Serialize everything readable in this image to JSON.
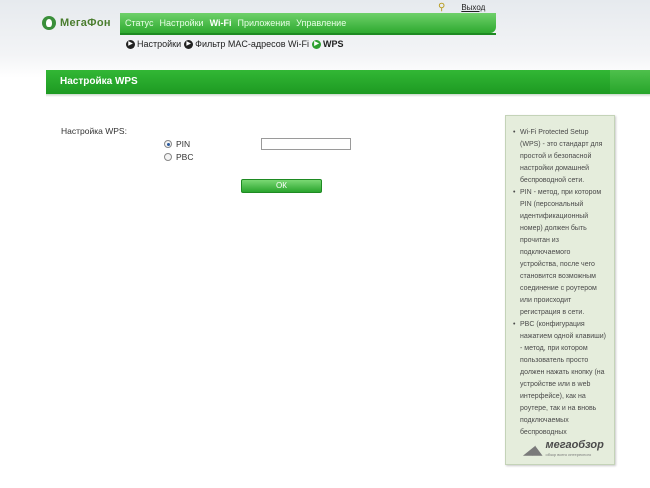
{
  "brand": {
    "name": "МегаФон"
  },
  "header": {
    "logout_label": "Выход",
    "user_icon": "user-key-icon",
    "nav": [
      {
        "label": "Статус",
        "active": false
      },
      {
        "label": "Настройки",
        "active": false
      },
      {
        "label": "Wi-Fi",
        "active": true
      },
      {
        "label": "Приложения",
        "active": false
      },
      {
        "label": "Управление",
        "active": false
      }
    ]
  },
  "breadcrumb": [
    {
      "label": "Настройки"
    },
    {
      "label": "Фильтр MAC-адресов Wi-Fi"
    },
    {
      "label": "WPS"
    }
  ],
  "section": {
    "title": "Настройка WPS"
  },
  "form": {
    "label": "Настройка WPS:",
    "options": [
      {
        "label": "PIN",
        "selected": true
      },
      {
        "label": "PBC",
        "selected": false
      }
    ],
    "pin_value": "",
    "ok_label": "ОК"
  },
  "help": {
    "items": [
      "Wi-Fi Protected Setup (WPS) - это стандарт для простой и безопасной настройки домашней беспроводной сети.",
      "PIN - метод, при котором PIN (персональный идентификационный номер) должен быть прочитан из подключаемого устройства, после чего становится возможным соединение с роутером или происходит регистрация в сети.",
      "PBC (конфигурация нажатием одной клавиши) - метод, при котором пользователь просто должен нажать кнопку (на устройстве или в web интерфейсе), как на роутере, так и на вновь подключаемых беспроводных"
    ]
  },
  "watermark": {
    "brand": "мегаобзор",
    "tagline": "обзор всего интересного"
  },
  "colors": {
    "accent": "#2eaa30",
    "nav_top": "#6fd06a",
    "help_bg": "#e5eddc"
  }
}
